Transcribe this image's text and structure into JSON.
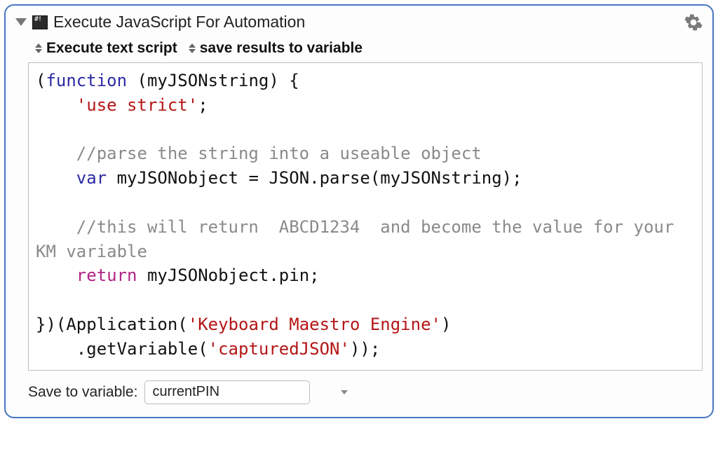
{
  "action": {
    "title": "Execute JavaScript For Automation",
    "option_mode": "Execute text script",
    "option_output": "save results to variable",
    "save_label": "Save to variable:",
    "save_value": "currentPIN"
  },
  "code": {
    "tokens": [
      {
        "t": "(",
        "c": "plain"
      },
      {
        "t": "function",
        "c": "fn"
      },
      {
        "t": " (myJSONstring) {\n",
        "c": "plain"
      },
      {
        "t": "    ",
        "c": "plain"
      },
      {
        "t": "'use strict'",
        "c": "str"
      },
      {
        "t": ";\n\n",
        "c": "plain"
      },
      {
        "t": "    ",
        "c": "plain"
      },
      {
        "t": "//parse the string into a useable object",
        "c": "com"
      },
      {
        "t": "\n    ",
        "c": "plain"
      },
      {
        "t": "var",
        "c": "fn"
      },
      {
        "t": " myJSONobject = JSON.parse(myJSONstring);\n\n",
        "c": "plain"
      },
      {
        "t": "    ",
        "c": "plain"
      },
      {
        "t": "//this will return  ABCD1234  and become the value for your KM variable",
        "c": "com"
      },
      {
        "t": "\n    ",
        "c": "plain"
      },
      {
        "t": "return",
        "c": "kw"
      },
      {
        "t": " myJSONobject.pin;\n\n})(Application(",
        "c": "plain"
      },
      {
        "t": "'Keyboard Maestro Engine'",
        "c": "str"
      },
      {
        "t": ")\n    .getVariable(",
        "c": "plain"
      },
      {
        "t": "'capturedJSON'",
        "c": "str"
      },
      {
        "t": "));",
        "c": "plain"
      }
    ]
  }
}
